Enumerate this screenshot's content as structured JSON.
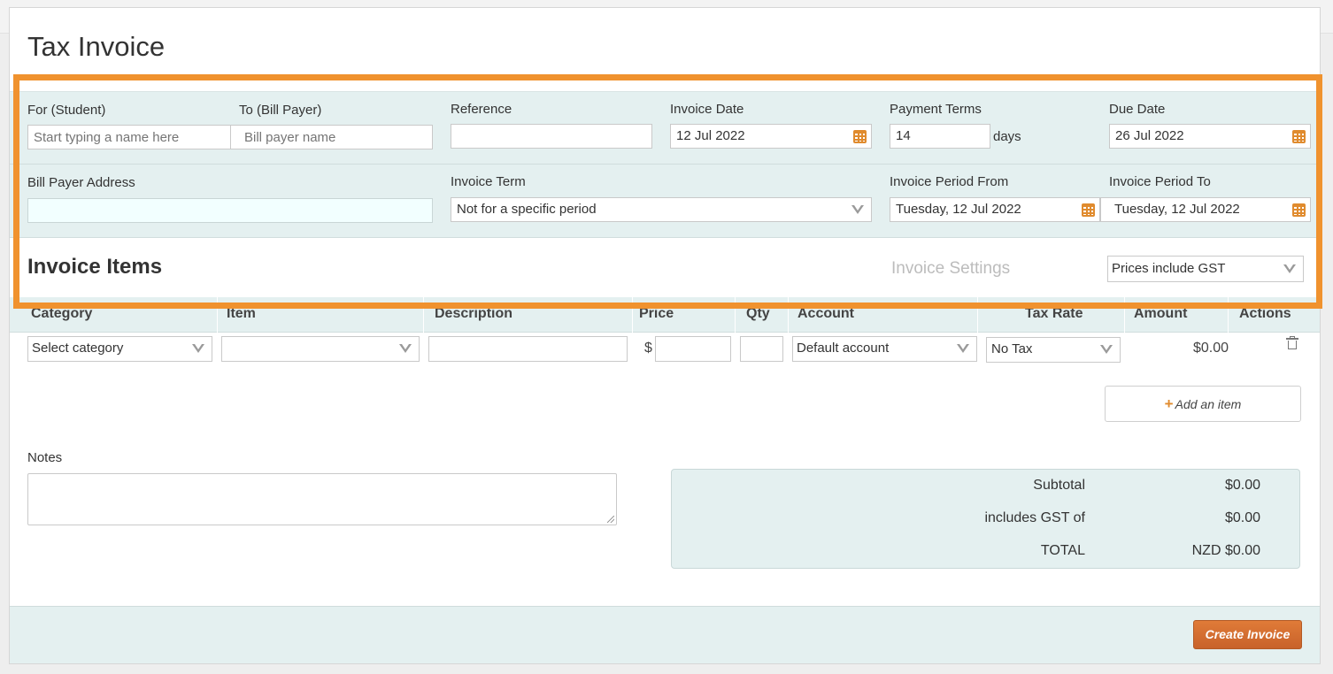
{
  "page": {
    "title": "Tax Invoice"
  },
  "header_fields": {
    "for_student": {
      "label": "For (Student)",
      "placeholder": "Start typing a name here"
    },
    "to_bill_payer": {
      "label": "To (Bill Payer)",
      "placeholder": "Bill payer name"
    },
    "reference": {
      "label": "Reference",
      "value": ""
    },
    "invoice_date": {
      "label": "Invoice Date",
      "value": "12 Jul 2022"
    },
    "payment_terms": {
      "label": "Payment Terms",
      "value": "14",
      "unit": "days"
    },
    "due_date": {
      "label": "Due Date",
      "value": "26 Jul 2022"
    },
    "bill_payer_address": {
      "label": "Bill Payer Address",
      "value": ""
    },
    "invoice_term": {
      "label": "Invoice Term",
      "value": "Not for a specific period"
    },
    "period_from": {
      "label": "Invoice Period From",
      "value": "Tuesday, 12 Jul 2022"
    },
    "period_to": {
      "label": "Invoice Period To",
      "value": "Tuesday, 12 Jul 2022"
    }
  },
  "items_section": {
    "title": "Invoice Items",
    "settings_link": "Invoice Settings",
    "gst_mode": "Prices include GST"
  },
  "table": {
    "headers": [
      "Category",
      "Item",
      "Description",
      "Price",
      "Qty",
      "Account",
      "Tax Rate",
      "Amount",
      "Actions"
    ],
    "row": {
      "category": "Select category",
      "item": "",
      "description": "",
      "currency_symbol": "$",
      "price": "",
      "qty": "",
      "account": "Default account",
      "tax_rate": "No Tax",
      "amount": "$0.00"
    },
    "add_item_label": "Add an item"
  },
  "notes": {
    "label": "Notes",
    "value": ""
  },
  "totals": {
    "subtotal_label": "Subtotal",
    "subtotal_value": "$0.00",
    "gst_label": "includes GST of",
    "gst_value": "$0.00",
    "total_label": "TOTAL",
    "total_value": "NZD $0.00"
  },
  "footer": {
    "create_label": "Create Invoice"
  },
  "colors": {
    "accent": "#e08b2e",
    "highlight": "#f0922e",
    "teal_band": "#e4f0f0",
    "button": "#d06c2f"
  }
}
